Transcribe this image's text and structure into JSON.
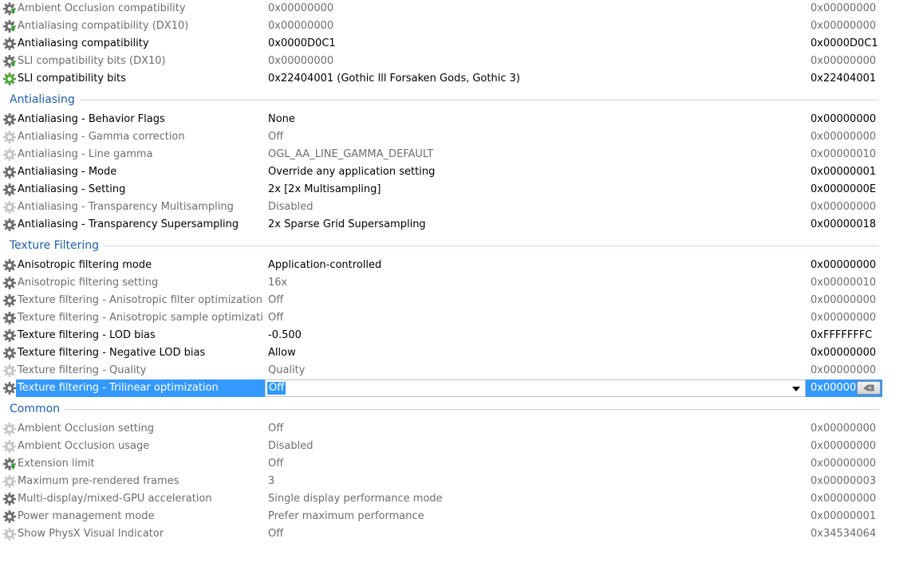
{
  "sections": [
    {
      "title": "",
      "rows": [
        {
          "name": "Ambient Occlusion compatibility",
          "value": "0x00000000",
          "hex": "0x00000000",
          "icon": "gear-shield-icon",
          "active": false
        },
        {
          "name": "Antialiasing compatibility (DX10)",
          "value": "0x00000000",
          "hex": "0x00000000",
          "icon": "gear-shield-icon",
          "active": false
        },
        {
          "name": "Antialiasing compatibility",
          "value": "0x0000D0C1",
          "hex": "0x0000D0C1",
          "icon": "gear-icon",
          "active": true
        },
        {
          "name": "SLI compatibility bits (DX10)",
          "value": "0x00000000",
          "hex": "0x00000000",
          "icon": "gear-shield-icon",
          "active": false
        },
        {
          "name": "SLI compatibility bits",
          "value": "0x22404001 (Gothic lll Forsaken Gods, Gothic 3)",
          "hex": "0x22404001",
          "icon": "gear-green-icon",
          "active": true
        }
      ]
    },
    {
      "title": "Antialiasing",
      "rows": [
        {
          "name": "Antialiasing - Behavior Flags",
          "value": "None",
          "hex": "0x00000000",
          "icon": "gear-icon",
          "active": true
        },
        {
          "name": "Antialiasing - Gamma correction",
          "value": "Off",
          "hex": "0x00000000",
          "icon": "gear-faded-icon",
          "active": false
        },
        {
          "name": "Antialiasing - Line gamma",
          "value": "OGL_AA_LINE_GAMMA_DEFAULT",
          "hex": "0x00000010",
          "icon": "gear-faded-icon",
          "active": false
        },
        {
          "name": "Antialiasing - Mode",
          "value": "Override any application setting",
          "hex": "0x00000001",
          "icon": "gear-icon",
          "active": true
        },
        {
          "name": "Antialiasing - Setting",
          "value": "2x [2x Multisampling]",
          "hex": "0x0000000E",
          "icon": "gear-icon",
          "active": true
        },
        {
          "name": "Antialiasing - Transparency Multisampling",
          "value": "Disabled",
          "hex": "0x00000000",
          "icon": "gear-faded-icon",
          "active": false
        },
        {
          "name": "Antialiasing - Transparency Supersampling",
          "value": "2x Sparse Grid Supersampling",
          "hex": "0x00000018",
          "icon": "gear-icon",
          "active": true
        }
      ]
    },
    {
      "title": "Texture Filtering",
      "rows": [
        {
          "name": "Anisotropic filtering mode",
          "value": "Application-controlled",
          "hex": "0x00000000",
          "icon": "gear-icon",
          "active": true
        },
        {
          "name": "Anisotropic filtering setting",
          "value": "16x",
          "hex": "0x00000010",
          "icon": "gear-icon",
          "active": false
        },
        {
          "name": "Texture filtering - Anisotropic filter optimization",
          "value": "Off",
          "hex": "0x00000000",
          "icon": "gear-icon",
          "active": false
        },
        {
          "name": "Texture filtering - Anisotropic sample optimizati...",
          "value": "Off",
          "hex": "0x00000000",
          "icon": "gear-icon",
          "active": false
        },
        {
          "name": "Texture filtering - LOD bias",
          "value": "-0.500",
          "hex": "0xFFFFFFFC",
          "icon": "gear-icon",
          "active": true
        },
        {
          "name": "Texture filtering - Negative LOD bias",
          "value": "Allow",
          "hex": "0x00000000",
          "icon": "gear-icon",
          "active": true
        },
        {
          "name": "Texture filtering - Quality",
          "value": "Quality",
          "hex": "0x00000000",
          "icon": "gear-faded-icon",
          "active": false
        },
        {
          "name": "Texture filtering - Trilinear optimization",
          "value": "Off",
          "hex": "0x000000",
          "icon": "gear-icon",
          "active": true,
          "selected": true
        }
      ]
    },
    {
      "title": "Common",
      "rows": [
        {
          "name": "Ambient Occlusion setting",
          "value": "Off",
          "hex": "0x00000000",
          "icon": "gear-faded-icon",
          "active": false
        },
        {
          "name": "Ambient Occlusion usage",
          "value": "Disabled",
          "hex": "0x00000000",
          "icon": "gear-faded-icon",
          "active": false
        },
        {
          "name": "Extension limit",
          "value": "Off",
          "hex": "0x00000000",
          "icon": "gear-shield-icon",
          "active": false
        },
        {
          "name": "Maximum pre-rendered frames",
          "value": "3",
          "hex": "0x00000003",
          "icon": "gear-faded-icon",
          "active": false
        },
        {
          "name": "Multi-display/mixed-GPU acceleration",
          "value": "Single display performance mode",
          "hex": "0x00000000",
          "icon": "gear-icon",
          "active": false
        },
        {
          "name": "Power management mode",
          "value": "Prefer maximum performance",
          "hex": "0x00000001",
          "icon": "gear-icon",
          "active": false
        },
        {
          "name": "Show PhysX Visual Indicator",
          "value": "Off",
          "hex": "0x34534064",
          "icon": "gear-faded-icon",
          "active": false
        }
      ]
    }
  ],
  "colors": {
    "selection": "#3399ff",
    "section_title": "#1e5ea8",
    "active_text": "#000000",
    "inactive_text": "#6d6d6d"
  }
}
